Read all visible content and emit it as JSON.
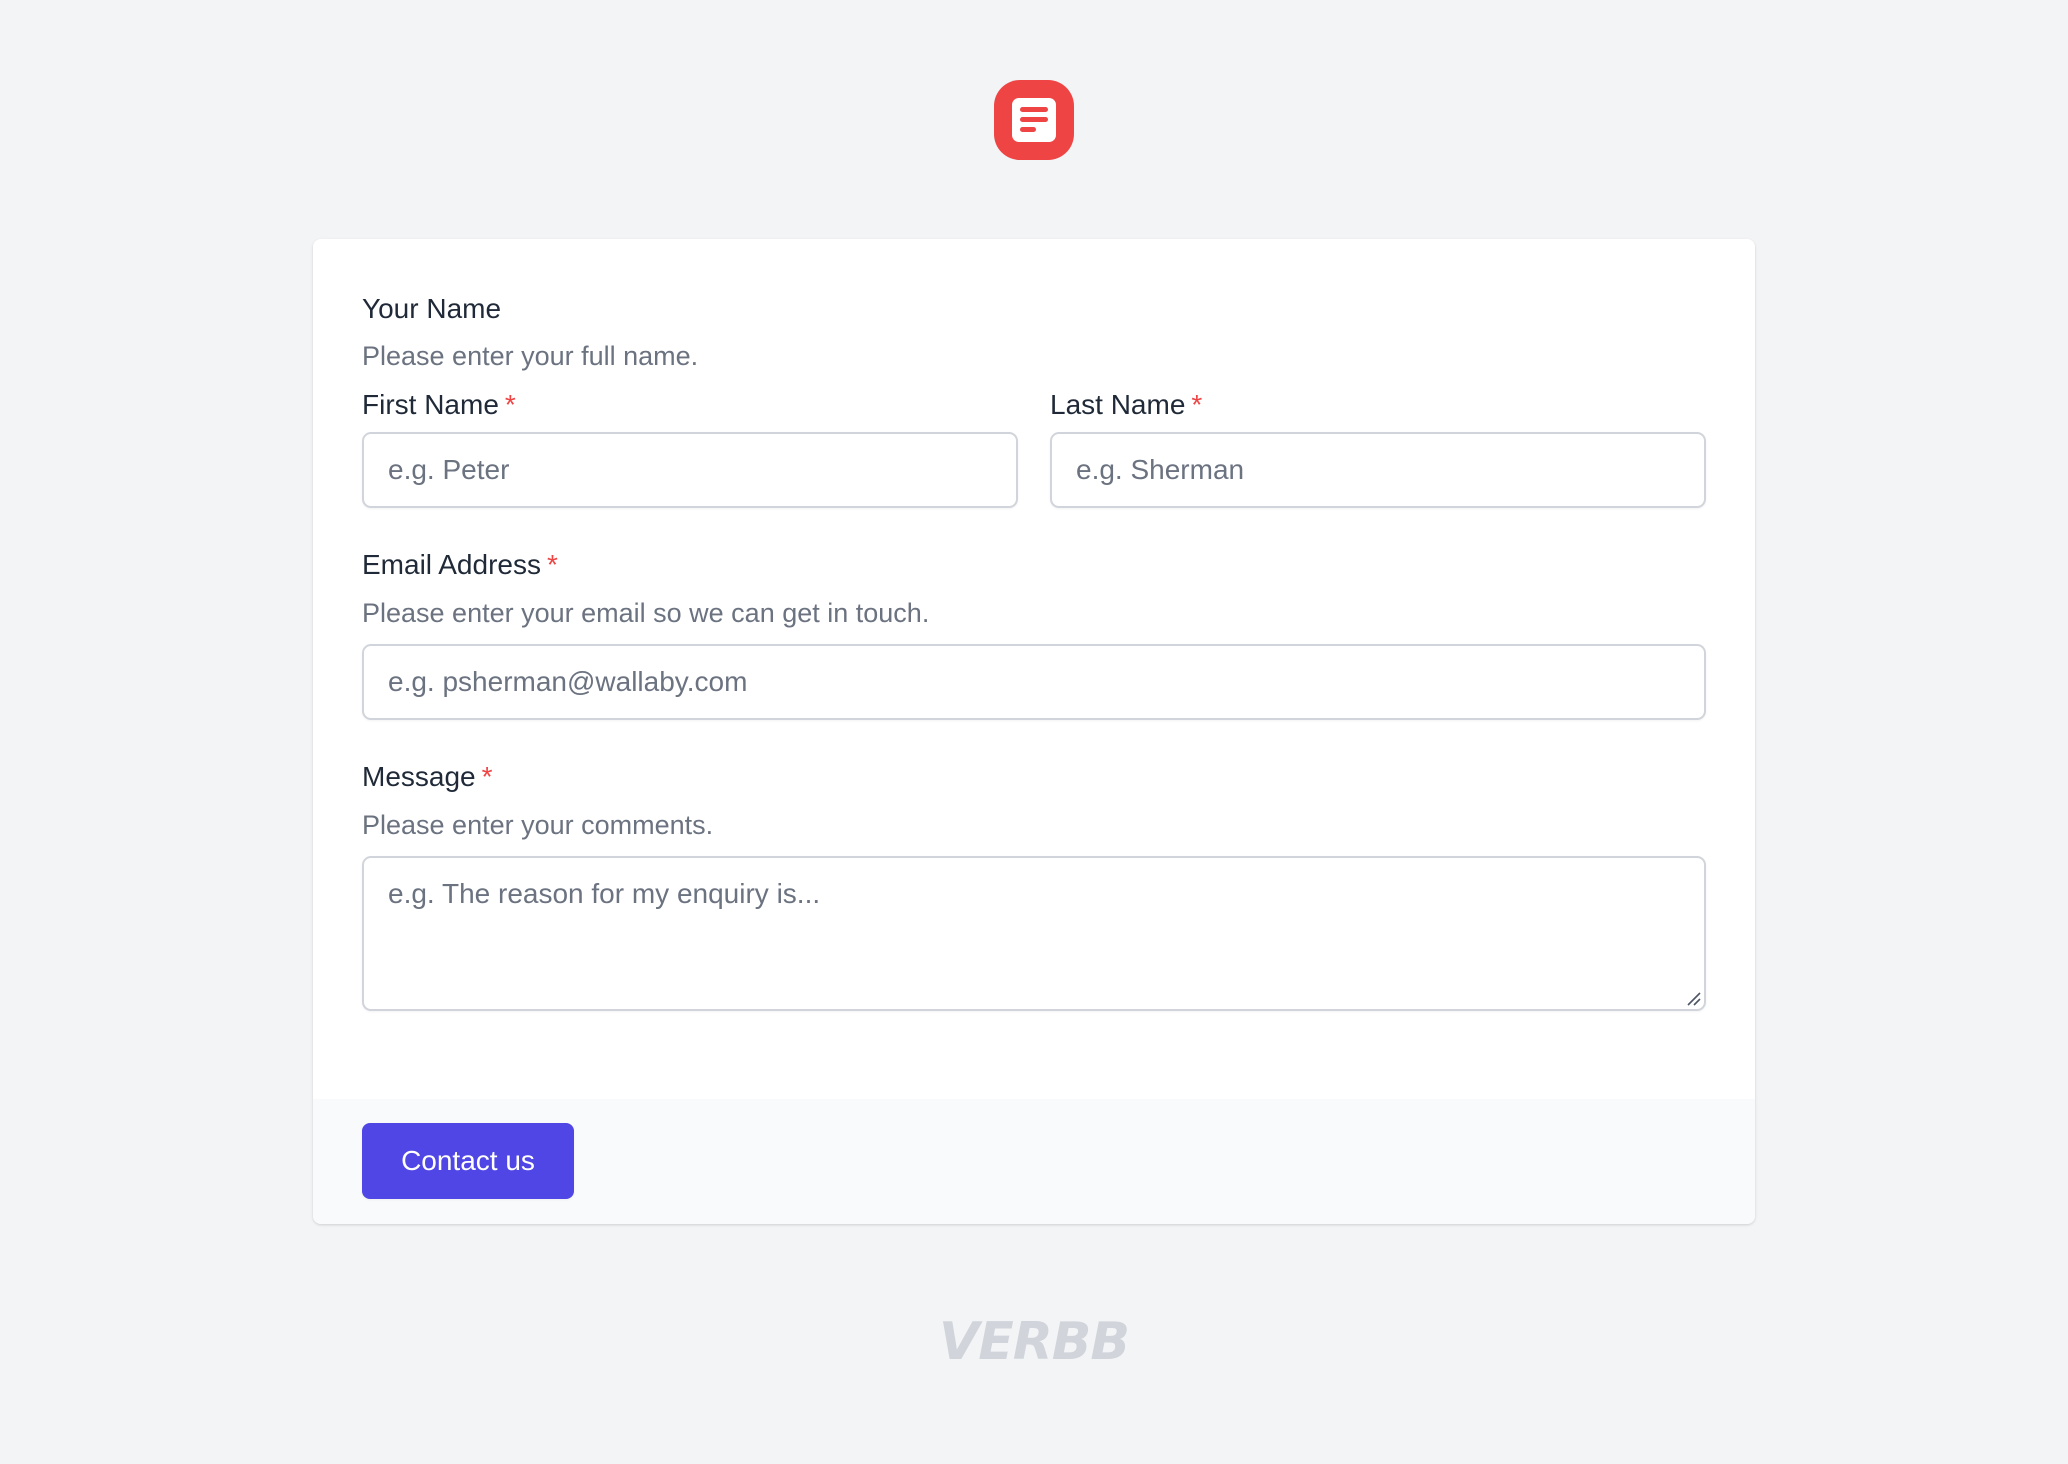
{
  "logo": {
    "icon": "document-icon",
    "color": "#ef4444"
  },
  "form": {
    "name_section": {
      "title": "Your Name",
      "help": "Please enter your full name."
    },
    "first_name": {
      "label": "First Name",
      "required_mark": "*",
      "placeholder": "e.g. Peter"
    },
    "last_name": {
      "label": "Last Name",
      "required_mark": "*",
      "placeholder": "e.g. Sherman"
    },
    "email": {
      "label": "Email Address",
      "required_mark": "*",
      "help": "Please enter your email so we can get in touch.",
      "placeholder": "e.g. psherman@wallaby.com"
    },
    "message": {
      "label": "Message",
      "required_mark": "*",
      "help": "Please enter your comments.",
      "placeholder": "e.g. The reason for my enquiry is..."
    },
    "submit_label": "Contact us"
  },
  "footer": {
    "brand": "VERBB"
  },
  "colors": {
    "background": "#f3f4f6",
    "accent": "#4f46e5",
    "required": "#ef4444",
    "logo": "#ef4444"
  }
}
